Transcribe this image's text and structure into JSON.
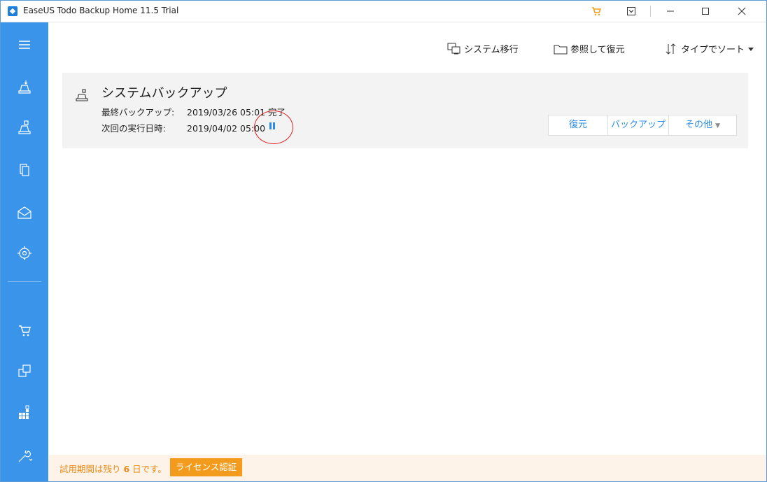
{
  "window": {
    "title": "EaseUS Todo Backup Home 11.5 Trial",
    "controls": [
      "cart-icon",
      "menu-icon",
      "minimize-icon",
      "maximize-icon",
      "close-icon"
    ]
  },
  "toolbar": {
    "migrate_label": "システム移行",
    "browse_restore_label": "参照して復元",
    "sort_label": "タイプでソート"
  },
  "sidebar": {
    "items": [
      "menu-icon",
      "system-backup-icon",
      "disk-backup-icon",
      "file-backup-icon",
      "mail-backup-icon",
      "smart-backup-icon",
      "cart-icon",
      "clone-icon",
      "tools-icon",
      "settings-icon"
    ]
  },
  "backup_card": {
    "title": "システムバックアップ",
    "last_backup_label": "最終バックアップ:",
    "last_backup_value": "2019/03/26 05:01 完了",
    "next_run_label": "次回の実行日時:",
    "next_run_value": "2019/04/02 05:00",
    "buttons": {
      "restore": "復元",
      "backup": "バックアップ",
      "more": "その他"
    }
  },
  "status": {
    "trial_prefix": "試用期間は残り ",
    "trial_days": "6",
    "trial_suffix": " 日です。",
    "license_button": "ライセンス認証"
  },
  "colors": {
    "sidebar": "#3a94ea",
    "accent": "#2b8be6",
    "trial_text": "#e88b1a",
    "license_button": "#f39b1d",
    "annotation_circle": "#e02020"
  }
}
